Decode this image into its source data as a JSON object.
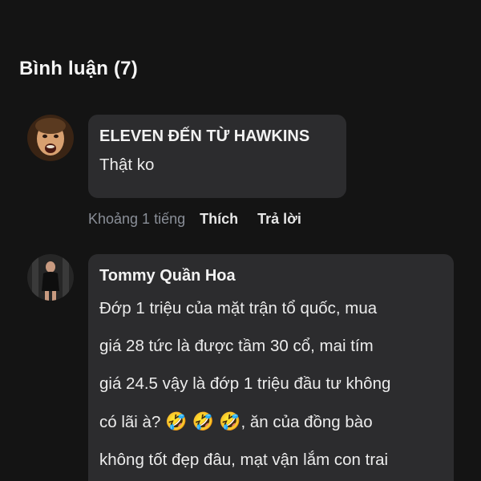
{
  "section": {
    "title": "Bình luận (7)"
  },
  "comments": [
    {
      "author": "ELEVEN ĐẾN TỪ HAWKINS",
      "text": "Thật ko",
      "time": "Khoảng 1 tiếng",
      "like_label": "Thích",
      "reply_label": "Trả lời"
    },
    {
      "author": "Tommy Quần Hoa",
      "lines": [
        "Đớp 1 triệu của mặt trận tổ quốc, mua",
        "giá 28 tức là được tầm 30 cổ, mai tím",
        "giá 24.5 vậy là đớp 1 triệu đầu tư không",
        "có lãi à?",
        ", ăn của đồng bào",
        "không tốt đẹp đâu, mạt vận lắm con trai"
      ],
      "emoji": "🤣 🤣 🤣"
    }
  ]
}
